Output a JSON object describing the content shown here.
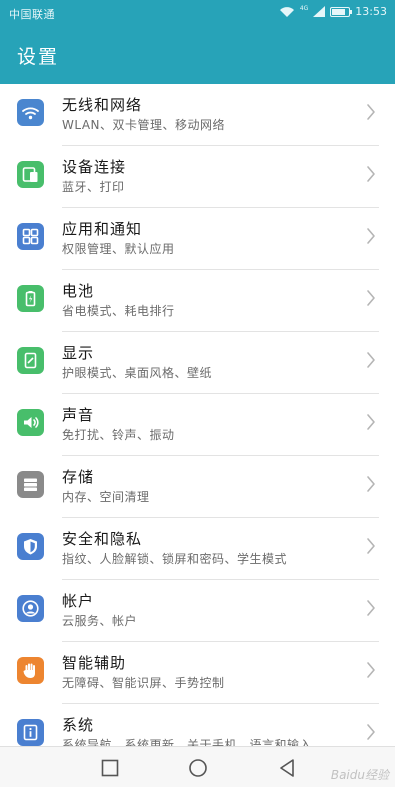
{
  "status_bar": {
    "carrier": "中国联通",
    "network": "4G",
    "time": "13:53",
    "battery_level": 0.8
  },
  "header": {
    "title": "设置"
  },
  "settings": [
    {
      "label": "无线和网络",
      "sub": "WLAN、双卡管理、移动网络",
      "icon": "wifi-icon",
      "color": "#4a86cf"
    },
    {
      "label": "设备连接",
      "sub": "蓝牙、打印",
      "icon": "device-connect-icon",
      "color": "#48be6b"
    },
    {
      "label": "应用和通知",
      "sub": "权限管理、默认应用",
      "icon": "apps-grid-icon",
      "color": "#4a7fd0"
    },
    {
      "label": "电池",
      "sub": "省电模式、耗电排行",
      "icon": "battery-icon",
      "color": "#48be6b"
    },
    {
      "label": "显示",
      "sub": "护眼模式、桌面风格、壁纸",
      "icon": "display-icon",
      "color": "#48be6b"
    },
    {
      "label": "声音",
      "sub": "免打扰、铃声、振动",
      "icon": "speaker-icon",
      "color": "#48be6b"
    },
    {
      "label": "存储",
      "sub": "内存、空间清理",
      "icon": "storage-icon",
      "color": "#8a8a8a"
    },
    {
      "label": "安全和隐私",
      "sub": "指纹、人脸解锁、锁屏和密码、学生模式",
      "icon": "shield-icon",
      "color": "#4a7fd0"
    },
    {
      "label": "帐户",
      "sub": "云服务、帐户",
      "icon": "account-icon",
      "color": "#4a7fd0"
    },
    {
      "label": "智能辅助",
      "sub": "无障碍、智能识屏、手势控制",
      "icon": "hand-icon",
      "color": "#ed8530"
    },
    {
      "label": "系统",
      "sub": "系统导航、系统更新、关于手机、语言和输入",
      "icon": "info-icon",
      "color": "#4a7fd0"
    }
  ],
  "watermark": "Baidu经验"
}
